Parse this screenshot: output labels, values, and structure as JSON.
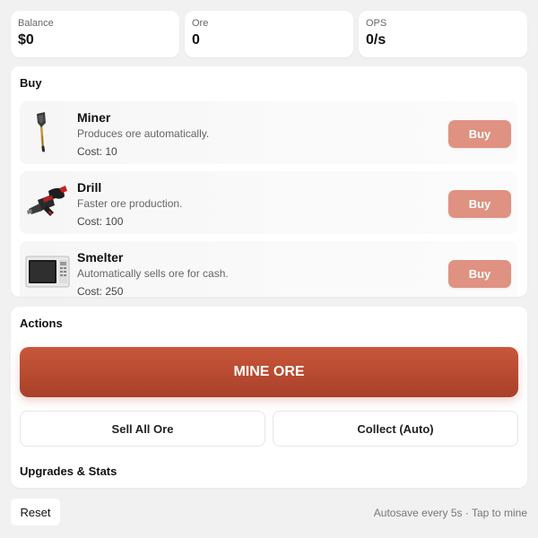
{
  "stats": {
    "balance": {
      "label": "Balance",
      "value": "$0"
    },
    "ore": {
      "label": "Ore",
      "value": "0"
    },
    "ops": {
      "label": "OPS",
      "value": "0/s"
    }
  },
  "buy": {
    "title": "Buy",
    "items": [
      {
        "name": "Miner",
        "description": "Produces ore automatically.",
        "cost": "Cost: 10",
        "button": "Buy",
        "icon": "shovel-icon"
      },
      {
        "name": "Drill",
        "description": "Faster ore production.",
        "cost": "Cost: 100",
        "button": "Buy",
        "icon": "drill-icon"
      },
      {
        "name": "Smelter",
        "description": "Automatically sells ore for cash.",
        "cost": "Cost: 250",
        "button": "Buy",
        "icon": "smelter-icon"
      }
    ],
    "button_color": "#df9281"
  },
  "actions": {
    "title": "Actions",
    "mine_label": "MINE ORE",
    "sell_label": "Sell All Ore",
    "collect_label": "Collect (Auto)",
    "upgrades_title": "Upgrades & Stats",
    "mine_color": "#b84a30"
  },
  "footer": {
    "reset_label": "Reset",
    "note": "Autosave every 5s · Tap to mine"
  }
}
